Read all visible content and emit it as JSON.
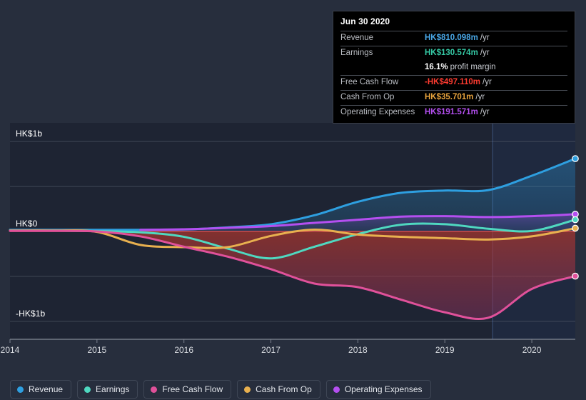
{
  "tooltip": {
    "date": "Jun 30 2020",
    "rows": [
      {
        "key": "Revenue",
        "value": "HK$810.098m",
        "suffix": "/yr",
        "color": "#4aa8e8"
      },
      {
        "key": "Earnings",
        "value": "HK$130.574m",
        "suffix": "/yr",
        "color": "#35c9a5"
      },
      {
        "key": "",
        "value": "16.1%",
        "suffix": "profit margin",
        "color": "#ffffff"
      },
      {
        "key": "Free Cash Flow",
        "value": "-HK$497.110m",
        "suffix": "/yr",
        "color": "#ff3b30"
      },
      {
        "key": "Cash From Op",
        "value": "HK$35.701m",
        "suffix": "/yr",
        "color": "#e8a33d"
      },
      {
        "key": "Operating Expenses",
        "value": "HK$191.571m",
        "suffix": "/yr",
        "color": "#b44ff0"
      }
    ]
  },
  "legend": {
    "items": [
      {
        "label": "Revenue",
        "color": "#2e9fe0"
      },
      {
        "label": "Earnings",
        "color": "#4fd8c0"
      },
      {
        "label": "Free Cash Flow",
        "color": "#e0519a"
      },
      {
        "label": "Cash From Op",
        "color": "#e8b04f"
      },
      {
        "label": "Operating Expenses",
        "color": "#b44ff0"
      }
    ]
  },
  "axes": {
    "y_ticks": [
      {
        "label": "HK$1b",
        "value": 1000
      },
      {
        "label": "HK$0",
        "value": 0
      },
      {
        "label": "-HK$1b",
        "value": -1000
      }
    ],
    "x_ticks": [
      "2014",
      "2015",
      "2016",
      "2017",
      "2018",
      "2019",
      "2020"
    ]
  },
  "chart_data": {
    "type": "area",
    "title": "",
    "xlabel": "",
    "ylabel": "HK$",
    "ylim": [
      -1200,
      1200
    ],
    "xlim": [
      2014,
      2020.5
    ],
    "grid": true,
    "legend_position": "bottom",
    "units": "HK$ millions",
    "forecast_start": 2019.55,
    "x": [
      2014.0,
      2014.5,
      2015.0,
      2015.5,
      2016.0,
      2016.5,
      2017.0,
      2017.5,
      2018.0,
      2018.5,
      2019.0,
      2019.5,
      2020.0,
      2020.5
    ],
    "series": [
      {
        "name": "Revenue",
        "color": "#2e9fe0",
        "values": [
          18,
          18,
          18,
          18,
          22,
          45,
          80,
          180,
          330,
          430,
          455,
          460,
          620,
          810.098
        ]
      },
      {
        "name": "Earnings",
        "color": "#4fd8c0",
        "values": [
          8,
          8,
          4,
          -10,
          -60,
          -190,
          -300,
          -170,
          -30,
          75,
          80,
          30,
          5,
          130.574
        ]
      },
      {
        "name": "Free Cash Flow",
        "color": "#e0519a",
        "values": [
          6,
          6,
          0,
          -55,
          -170,
          -280,
          -420,
          -580,
          -620,
          -760,
          -900,
          -960,
          -640,
          -497.11
        ]
      },
      {
        "name": "Cash From Op",
        "color": "#e8b04f",
        "values": [
          10,
          10,
          -5,
          -150,
          -175,
          -175,
          -50,
          20,
          -35,
          -60,
          -75,
          -90,
          -55,
          35.701
        ]
      },
      {
        "name": "Operating Expenses",
        "color": "#b44ff0",
        "values": [
          null,
          null,
          null,
          18,
          24,
          40,
          60,
          95,
          130,
          165,
          170,
          160,
          170,
          191.571
        ]
      }
    ]
  }
}
